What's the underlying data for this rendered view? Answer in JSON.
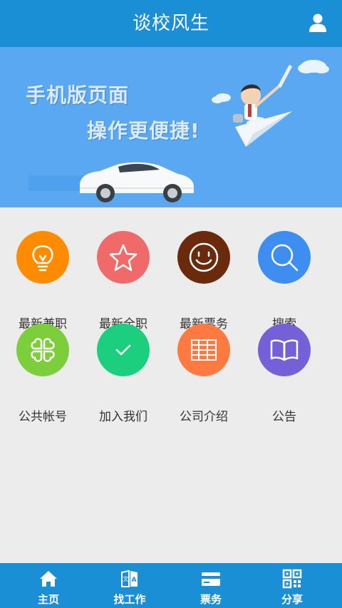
{
  "header": {
    "title": "谈校风生",
    "user_icon": "user-icon"
  },
  "banner": {
    "line1": "手机版页面",
    "line2": "操作更便捷!"
  },
  "menu": [
    {
      "label": "最新兼职",
      "icon": "lightbulb-icon",
      "color": "#ff8c00"
    },
    {
      "label": "最新全职",
      "icon": "star-icon",
      "color": "#f06a6a"
    },
    {
      "label": "最新票务",
      "icon": "smiley-icon",
      "color": "#6b2a0c"
    },
    {
      "label": "搜索",
      "icon": "search-icon",
      "color": "#3d8ef0"
    },
    {
      "label": "公共帐号",
      "icon": "clover-icon",
      "color": "#7ccf3a"
    },
    {
      "label": "加入我们",
      "icon": "check-icon",
      "color": "#1ccf7e"
    },
    {
      "label": "公司介绍",
      "icon": "table-icon",
      "color": "#ff7a40"
    },
    {
      "label": "公告",
      "icon": "book-icon",
      "color": "#7560d8"
    }
  ],
  "tabs": [
    {
      "label": "主页",
      "icon": "home-icon"
    },
    {
      "label": "找工作",
      "icon": "translate-book-icon"
    },
    {
      "label": "票务",
      "icon": "card-icon"
    },
    {
      "label": "分享",
      "icon": "qrcode-icon"
    }
  ],
  "colors": {
    "primary": "#1a8fd6",
    "banner_bg": "#5aa8f2",
    "page_bg": "#ececec"
  }
}
